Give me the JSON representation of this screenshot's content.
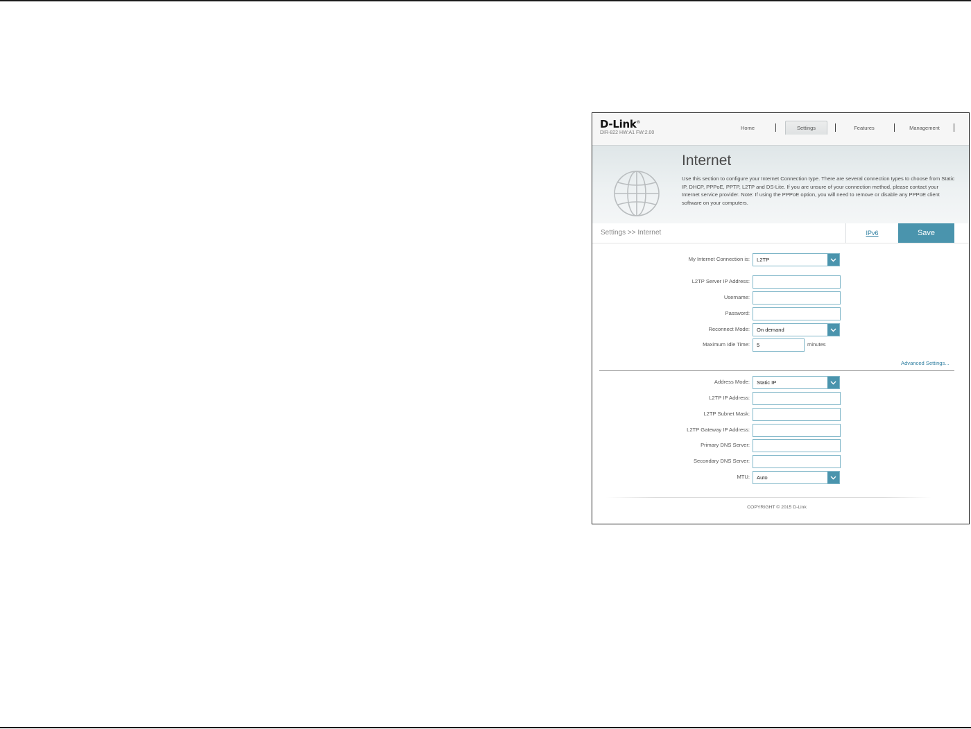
{
  "header": {
    "brand": "D-Link",
    "brand_mark": "®",
    "model": "DIR-822 HW:A1 FW:2.00",
    "nav": {
      "home": "Home",
      "settings": "Settings",
      "features": "Features",
      "management": "Management"
    },
    "active_nav": "Settings"
  },
  "banner": {
    "title": "Internet",
    "description": "Use this section to configure your Internet Connection type. There are several connection types to choose from Static IP, DHCP, PPPoE, PPTP, L2TP and DS-Lite. If you are unsure of your connection method, please contact your Internet service provider. Note: If using the PPPoE option, you will need to remove or disable any PPPoE client software on your computers.",
    "icon": "globe-icon"
  },
  "breadcrumb": {
    "text": "Settings >> Internet",
    "ipv6_label": "IPv6",
    "save_label": "Save"
  },
  "form": {
    "connection": {
      "label": "My Internet Connection is:",
      "value": "L2TP"
    },
    "server_ip": {
      "label": "L2TP Server IP Address:",
      "value": ""
    },
    "username": {
      "label": "Username:",
      "value": ""
    },
    "password": {
      "label": "Password:",
      "value": ""
    },
    "reconnect": {
      "label": "Reconnect Mode:",
      "value": "On demand"
    },
    "idle_time": {
      "label": "Maximum Idle Time:",
      "value": "5",
      "unit": "minutes"
    },
    "advanced_link": "Advanced Settings...",
    "address_mode": {
      "label": "Address Mode:",
      "value": "Static IP"
    },
    "l2tp_ip": {
      "label": "L2TP IP Address:",
      "value": ""
    },
    "subnet": {
      "label": "L2TP Subnet Mask:",
      "value": ""
    },
    "gateway": {
      "label": "L2TP Gateway IP Address:",
      "value": ""
    },
    "primary_dns": {
      "label": "Primary DNS Server:",
      "value": ""
    },
    "secondary_dns": {
      "label": "Secondary DNS Server:",
      "value": ""
    },
    "mtu": {
      "label": "MTU:",
      "value": "Auto"
    }
  },
  "footer": {
    "copyright": "COPYRIGHT © 2015 D-Link"
  },
  "colors": {
    "accent": "#4a94ad",
    "link": "#2e7ea0",
    "field_border": "#7fb6c8"
  }
}
